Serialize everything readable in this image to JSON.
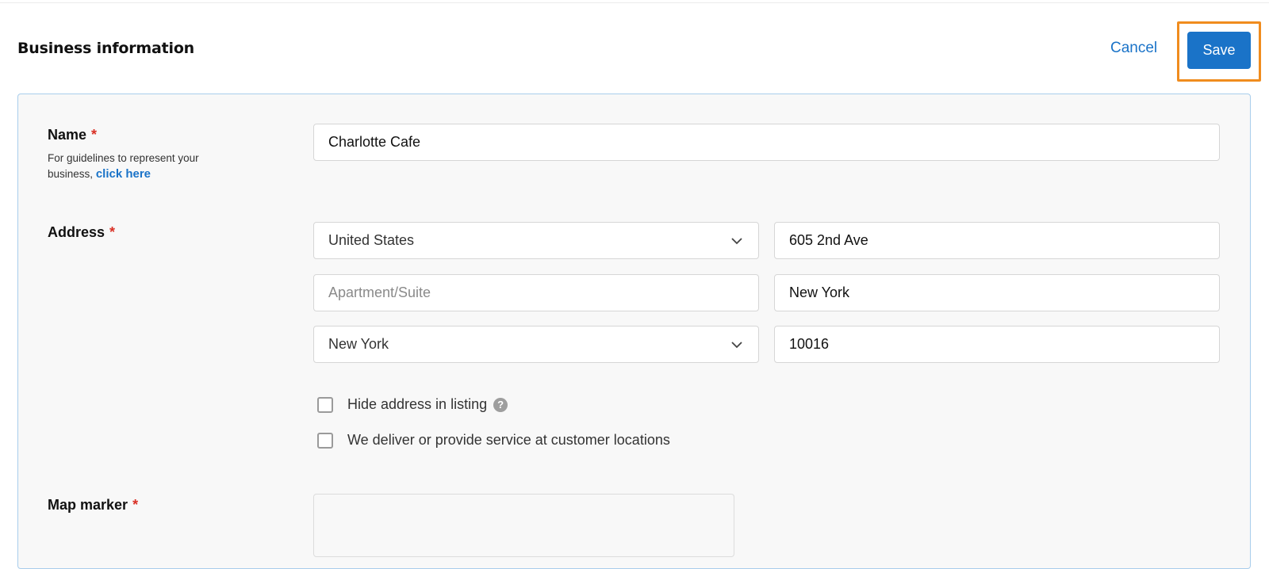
{
  "header": {
    "title": "Business information",
    "cancel_label": "Cancel",
    "save_label": "Save"
  },
  "colors": {
    "accent": "#1a73c8",
    "highlight": "#f08c1e",
    "required": "#d93025",
    "panel_border": "#a8cdec"
  },
  "name_section": {
    "label": "Name",
    "required_mark": "*",
    "hint_text": "For guidelines to represent your business,",
    "hint_link": "click here",
    "value": "Charlotte Cafe"
  },
  "address_section": {
    "label": "Address",
    "required_mark": "*",
    "country": "United States",
    "street": "605 2nd Ave",
    "apartment_placeholder": "Apartment/Suite",
    "city": "New York",
    "state": "New York",
    "zip": "10016",
    "hide_address_label": "Hide address in listing",
    "help_icon_glyph": "?",
    "deliver_label": "We deliver or provide service at customer locations"
  },
  "map_section": {
    "label": "Map marker",
    "required_mark": "*"
  }
}
